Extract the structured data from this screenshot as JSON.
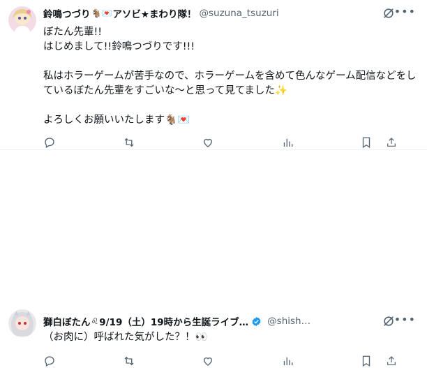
{
  "tweets": [
    {
      "display_name": "鈴鳴つづり",
      "name_emoji": "🐐💌",
      "name_suffix": "アソビ★まわり隊！",
      "handle": "@suzuna_tsuzuri",
      "verified": false,
      "body": "ぼたん先輩!!\nはじめまして!!鈴鳴つづりです!!!\n\n私はホラーゲームが苦手なので、ホラーゲームを含めて色んなゲーム配信などをしているぼたん先輩をすごいな～と思って見てました✨\n\nよろしくお願いいたします🐐💌"
    },
    {
      "display_name": "獅白ぼたん",
      "name_emoji": "♌",
      "name_suffix": "9/19（土）19時から生誕ライブ…",
      "handle": "@shish…",
      "verified": true,
      "body": "（お肉に）呼ばれた気がした？！👀"
    }
  ],
  "icons": {
    "more": "more-icon",
    "grok": "grok-icon",
    "reply": "reply-icon",
    "retweet": "retweet-icon",
    "like": "like-icon",
    "views": "views-icon",
    "bookmark": "bookmark-icon",
    "share": "share-icon",
    "verified": "verified-badge-icon"
  },
  "colors": {
    "text": "#0f1419",
    "secondary": "#536471",
    "verified": "#1d9bf0",
    "divider": "#eff3f4"
  }
}
